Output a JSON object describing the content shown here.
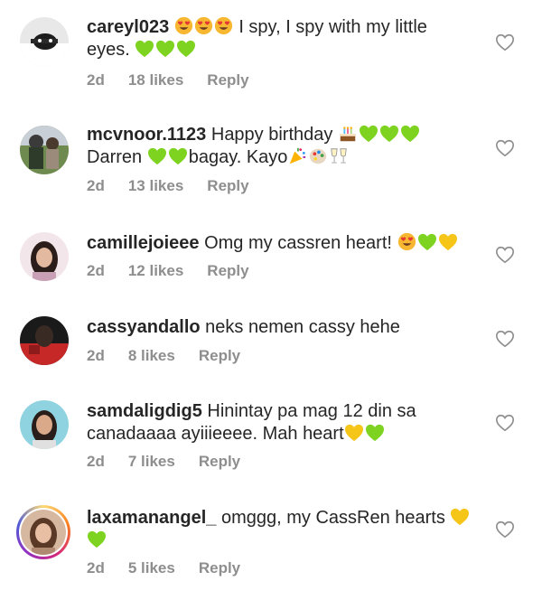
{
  "comments": [
    {
      "username": "careyl023",
      "text_a": " I spy, I spy with my little",
      "text_b": "eyes. ",
      "time": "2d",
      "likes": "18 likes",
      "reply": "Reply"
    },
    {
      "username": "mcvnoor.1123",
      "text_a": " Happy birthday ",
      "text_b": "Darren ",
      "text_c": "bagay. Kayo",
      "time": "2d",
      "likes": "13 likes",
      "reply": "Reply"
    },
    {
      "username": "camillejoieee",
      "text_a": " Omg my cassren heart! ",
      "time": "2d",
      "likes": "12 likes",
      "reply": "Reply"
    },
    {
      "username": "cassyandallo",
      "text_a": " neks nemen cassy hehe",
      "time": "2d",
      "likes": "8 likes",
      "reply": "Reply"
    },
    {
      "username": "samdaligdig5",
      "text_a": " Hinintay pa mag 12 din sa",
      "text_b": "canadaaaa ayiiieeee. Mah heart",
      "time": "2d",
      "likes": "7 likes",
      "reply": "Reply"
    },
    {
      "username": "laxamanangel_",
      "text_a": " omggg, my CassRen hearts ",
      "time": "2d",
      "likes": "5 likes",
      "reply": "Reply"
    }
  ],
  "icons": {
    "like": "heart-outline-icon",
    "green_heart": "green-heart-emoji",
    "yellow_heart": "yellow-heart-emoji",
    "heart_eyes": "heart-eyes-emoji"
  },
  "colors": {
    "username": "#262626",
    "meta": "#8e8e8e",
    "green_heart": "#7ed321",
    "yellow_heart": "#f5c518"
  }
}
